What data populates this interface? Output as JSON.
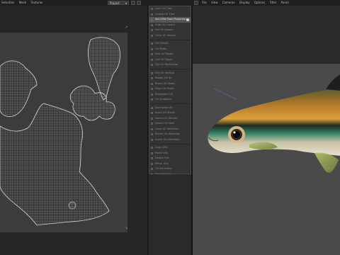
{
  "uv_menu": {
    "items": [
      "Selection",
      "Mesh",
      "Textures"
    ]
  },
  "project_dropdown": {
    "value": "Project"
  },
  "viewport_menu": {
    "items": [
      "File",
      "View",
      "Cameras",
      "Display",
      "Options",
      "Filter",
      "Panel"
    ]
  },
  "ops_menu": {
    "items": [
      {
        "label": "Lock UV Tiles",
        "active": false
      },
      {
        "label": "Unlock UV Tiles",
        "active": false
      },
      {
        "label": "Set UVW From Projection",
        "active": true
      },
      {
        "label": "Auto UV Layout",
        "active": false
      },
      {
        "label": "Set UV Seams",
        "active": false
      },
      {
        "label": "Clear UV Seams",
        "active": false
      },
      {
        "label": "UV Unfold",
        "active": false
      },
      {
        "label": "UV Relax",
        "active": false
      },
      {
        "label": "Sew UV Edges",
        "active": false
      },
      {
        "label": "Cut UV Edges",
        "active": false
      },
      {
        "label": "Flip UV Horizontal",
        "active": false
      },
      {
        "label": "Flip UV Vertical",
        "active": false
      },
      {
        "label": "Rotate UV 90",
        "active": false
      },
      {
        "label": "Stack UV Shells",
        "active": false
      },
      {
        "label": "Align UV Shells",
        "active": false
      },
      {
        "label": "Straighten UV",
        "active": false
      },
      {
        "label": "UV Snapshot",
        "active": false
      },
      {
        "label": "Normalize UV",
        "active": false
      },
      {
        "label": "Scale UV Shells",
        "active": false
      },
      {
        "label": "Match UV Density",
        "active": false
      },
      {
        "label": "Select UV Shell",
        "active": false
      },
      {
        "label": "Grow UV Selection",
        "active": false
      },
      {
        "label": "Shrink UV Selection",
        "active": false
      },
      {
        "label": "Invert UV Selection",
        "active": false
      },
      {
        "label": "Copy UVs",
        "active": false
      },
      {
        "label": "Paste UVs",
        "active": false
      },
      {
        "label": "Delete UVs",
        "active": false
      },
      {
        "label": "Mirror UVs",
        "active": false
      },
      {
        "label": "UV Set Editor",
        "active": false
      },
      {
        "label": "Transfer UVs",
        "active": false
      },
      {
        "label": "Rename UV Set",
        "active": false
      },
      {
        "label": "Close UV Editor",
        "active": false
      }
    ]
  },
  "colors": {
    "accent": "#c89b3c",
    "panel_bg": "#262626",
    "uv_grid": "#3c3c3c",
    "scene_bg": "#4a4a4a"
  }
}
